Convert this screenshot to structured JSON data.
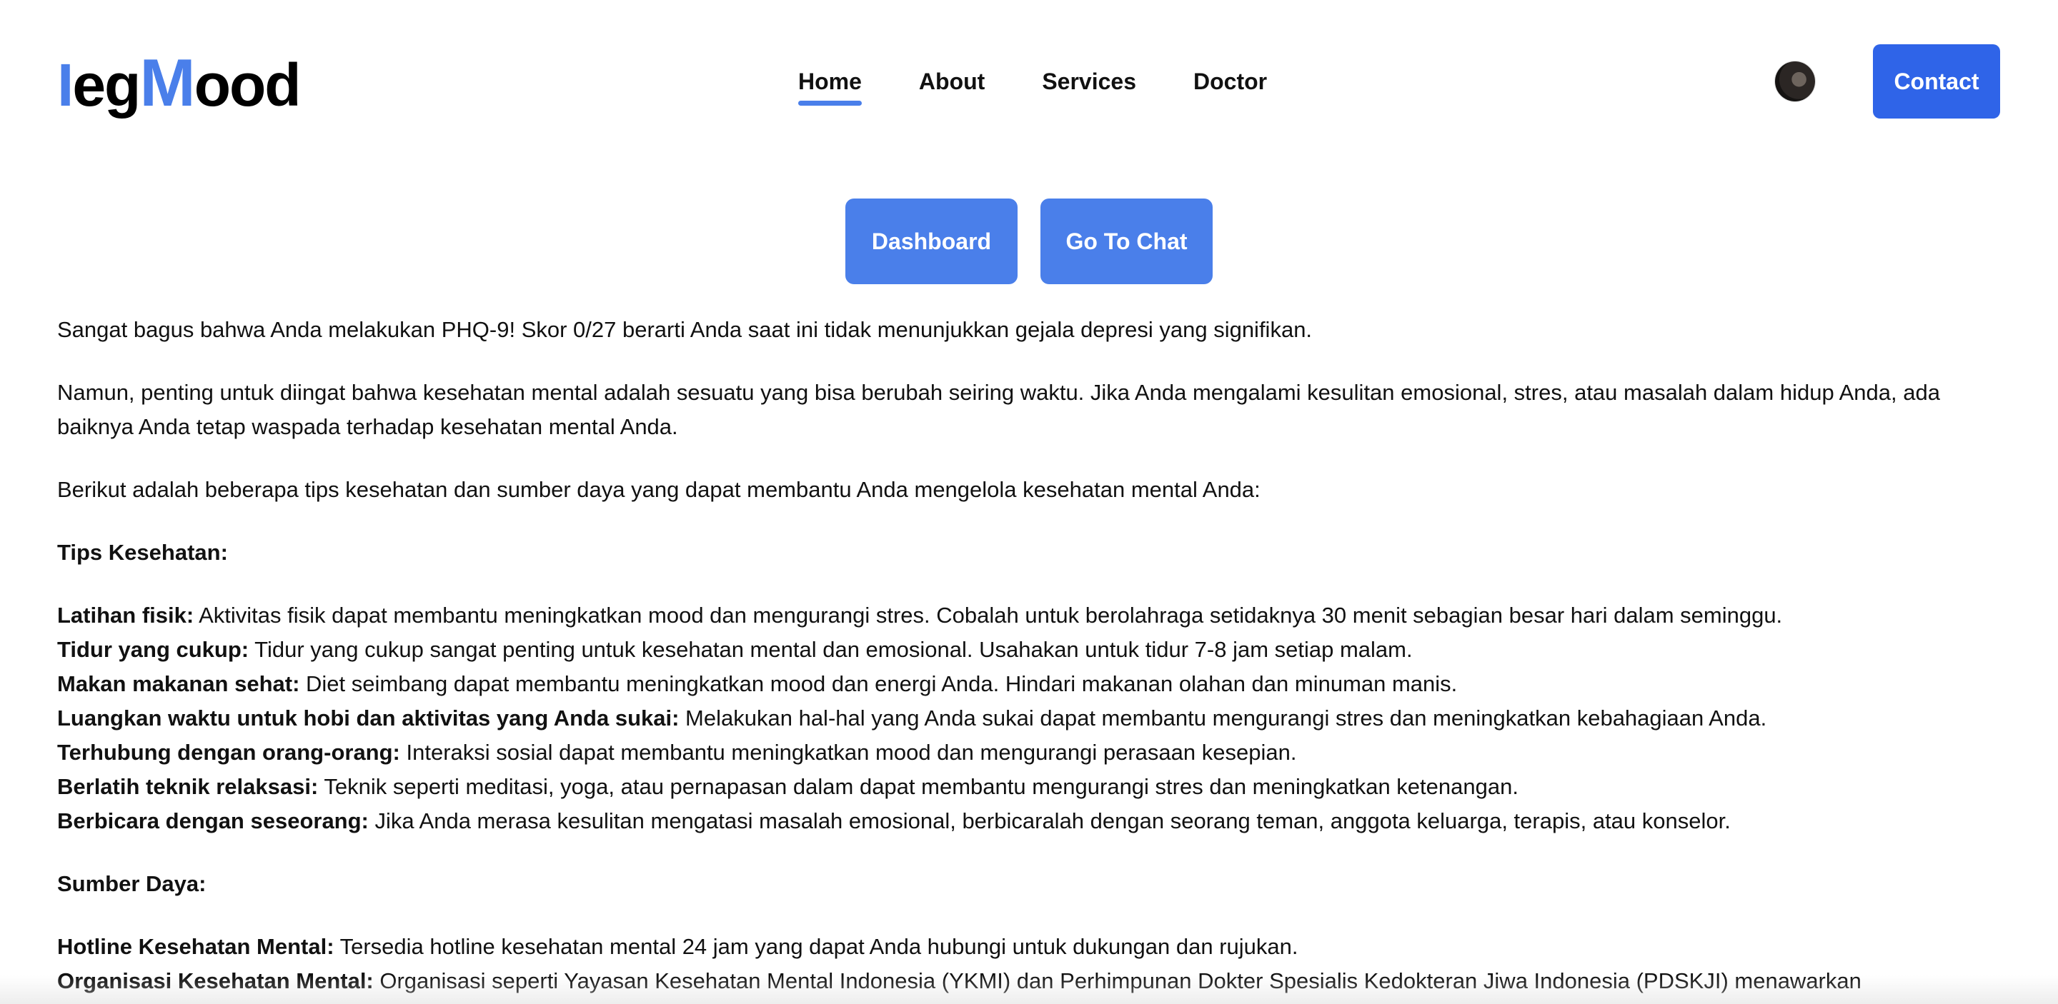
{
  "header": {
    "logo": {
      "part1": "I",
      "part2": "eg",
      "part3": "M",
      "part4": "ood"
    },
    "nav": [
      {
        "label": "Home",
        "active": true
      },
      {
        "label": "About",
        "active": false
      },
      {
        "label": "Services",
        "active": false
      },
      {
        "label": "Doctor",
        "active": false
      }
    ],
    "contact_label": "Contact"
  },
  "actions": {
    "dashboard_label": "Dashboard",
    "chat_label": "Go To Chat"
  },
  "content": {
    "intro": "Sangat bagus bahwa Anda melakukan PHQ-9! Skor 0/27 berarti Anda saat ini tidak menunjukkan gejala depresi yang signifikan.",
    "note": "Namun, penting untuk diingat bahwa kesehatan mental adalah sesuatu yang bisa berubah seiring waktu. Jika Anda mengalami kesulitan emosional, stres, atau masalah dalam hidup Anda, ada baiknya Anda tetap waspada terhadap kesehatan mental Anda.",
    "lead": "Berikut adalah beberapa tips kesehatan dan sumber daya yang dapat membantu Anda mengelola kesehatan mental Anda:",
    "tips_title": "Tips Kesehatan:",
    "tips": [
      {
        "title": "Latihan fisik:",
        "text": " Aktivitas fisik dapat membantu meningkatkan mood dan mengurangi stres. Cobalah untuk berolahraga setidaknya 30 menit sebagian besar hari dalam seminggu."
      },
      {
        "title": "Tidur yang cukup:",
        "text": " Tidur yang cukup sangat penting untuk kesehatan mental dan emosional. Usahakan untuk tidur 7-8 jam setiap malam."
      },
      {
        "title": "Makan makanan sehat:",
        "text": " Diet seimbang dapat membantu meningkatkan mood dan energi Anda. Hindari makanan olahan dan minuman manis."
      },
      {
        "title": "Luangkan waktu untuk hobi dan aktivitas yang Anda sukai:",
        "text": " Melakukan hal-hal yang Anda sukai dapat membantu mengurangi stres dan meningkatkan kebahagiaan Anda."
      },
      {
        "title": "Terhubung dengan orang-orang:",
        "text": " Interaksi sosial dapat membantu meningkatkan mood dan mengurangi perasaan kesepian."
      },
      {
        "title": "Berlatih teknik relaksasi:",
        "text": " Teknik seperti meditasi, yoga, atau pernapasan dalam dapat membantu mengurangi stres dan meningkatkan ketenangan."
      },
      {
        "title": "Berbicara dengan seseorang:",
        "text": " Jika Anda merasa kesulitan mengatasi masalah emosional, berbicaralah dengan seorang teman, anggota keluarga, terapis, atau konselor."
      }
    ],
    "resources_title": "Sumber Daya:",
    "resources": [
      {
        "title": "Hotline Kesehatan Mental:",
        "text": " Tersedia hotline kesehatan mental 24 jam yang dapat Anda hubungi untuk dukungan dan rujukan."
      },
      {
        "title": "Organisasi Kesehatan Mental:",
        "text": " Organisasi seperti Yayasan Kesehatan Mental Indonesia (YKMI) dan Perhimpunan Dokter Spesialis Kedokteran Jiwa Indonesia (PDSKJI) menawarkan"
      }
    ]
  },
  "colors": {
    "accent": "#4a7fea",
    "contact": "#2f64e8",
    "text": "#111111"
  },
  "icons": {
    "avatar": "user-avatar"
  }
}
